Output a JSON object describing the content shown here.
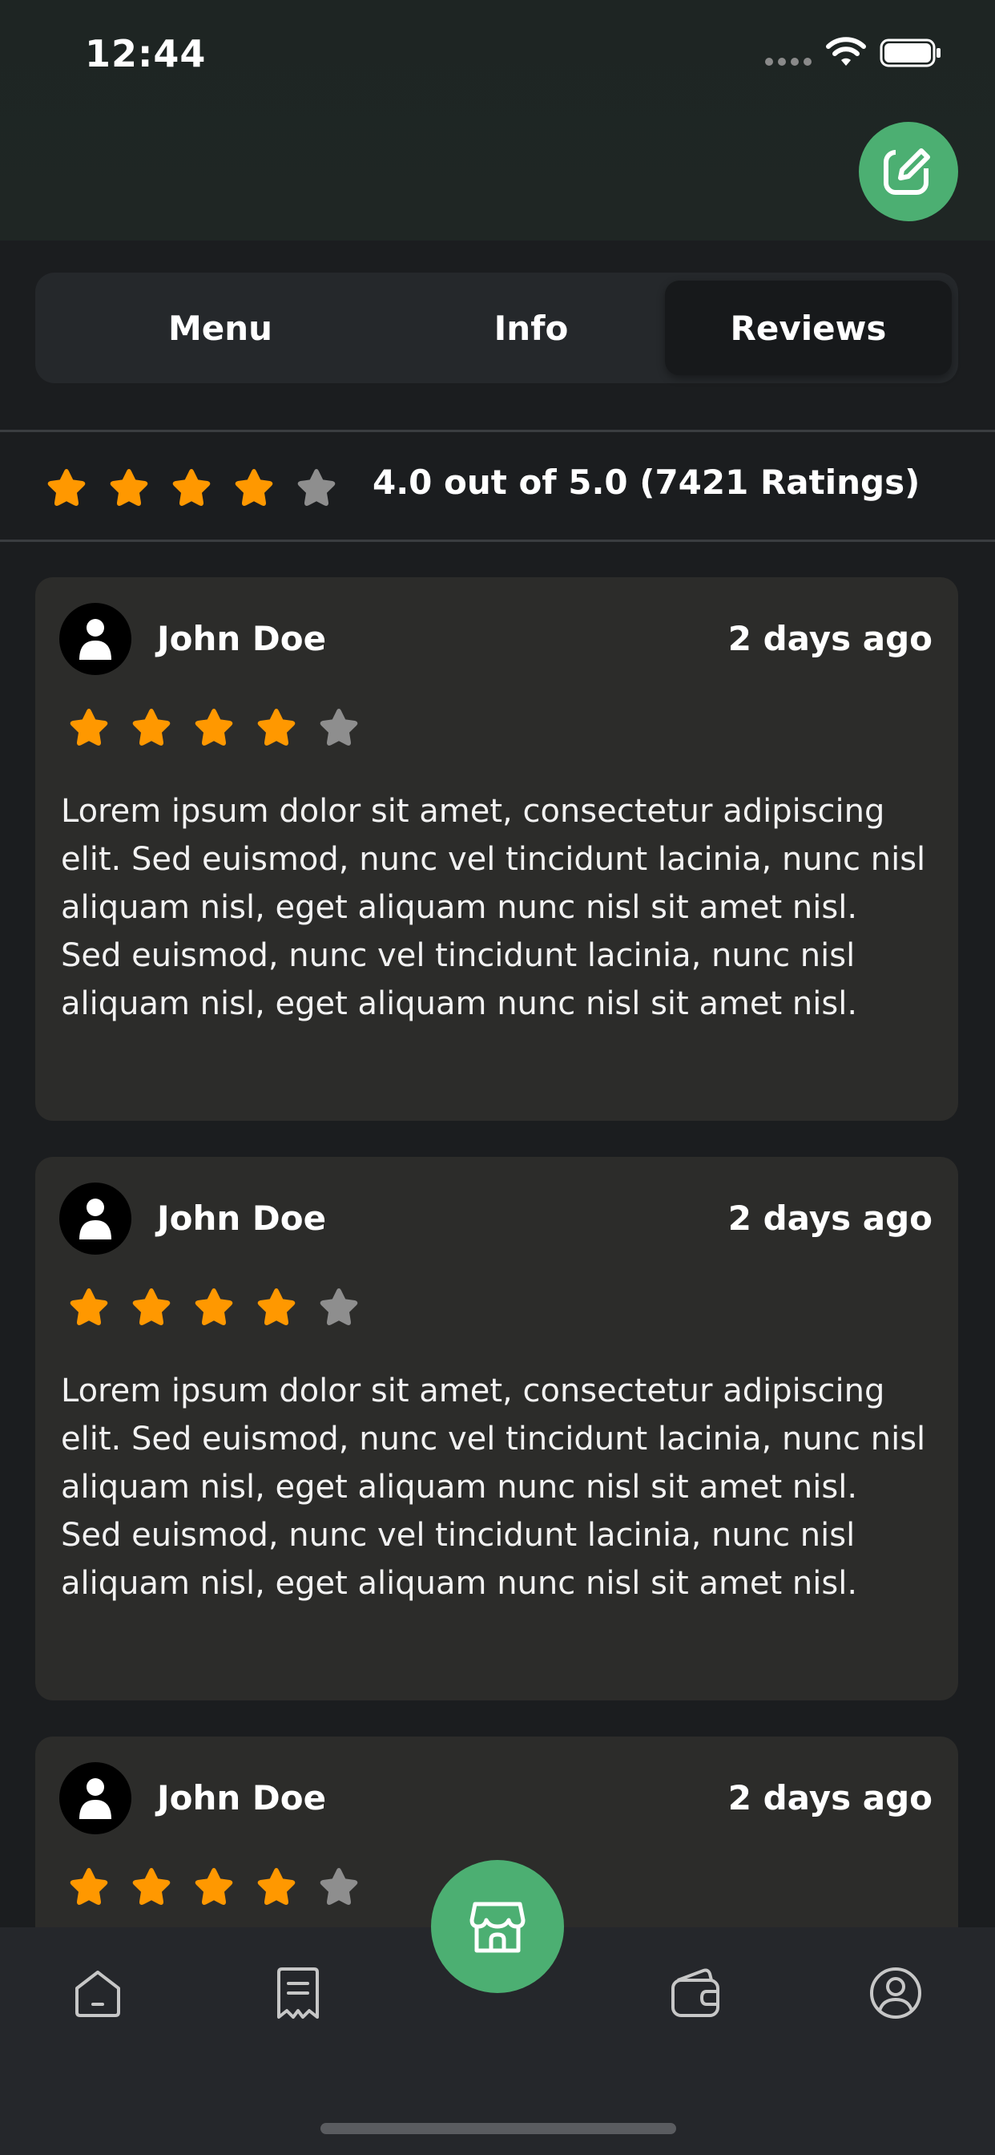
{
  "status_bar": {
    "time": "12:44"
  },
  "tabs": [
    {
      "label": "Menu",
      "selected": false
    },
    {
      "label": "Info",
      "selected": false
    },
    {
      "label": "Reviews",
      "selected": true
    }
  ],
  "overall_rating": {
    "value": 4,
    "max": 5,
    "summary_text": "4.0 out of 5.0 (7421 Ratings)"
  },
  "reviews": [
    {
      "name": "John Doe",
      "date": "2 days ago",
      "rating": 4,
      "text": "Lorem ipsum dolor sit amet, consectetur adipiscing elit. Sed euismod, nunc vel tincidunt lacinia, nunc nisl aliquam nisl, eget aliquam nunc nisl sit amet nisl. Sed euismod, nunc vel tincidunt lacinia, nunc nisl aliquam nisl, eget aliquam nunc nisl sit amet nisl."
    },
    {
      "name": "John Doe",
      "date": "2 days ago",
      "rating": 4,
      "text": "Lorem ipsum dolor sit amet, consectetur adipiscing elit. Sed euismod, nunc vel tincidunt lacinia, nunc nisl aliquam nisl, eget aliquam nunc nisl sit amet nisl. Sed euismod, nunc vel tincidunt lacinia, nunc nisl aliquam nisl, eget aliquam nunc nisl sit amet nisl."
    },
    {
      "name": "John Doe",
      "date": "2 days ago",
      "rating": 4,
      "text": ""
    }
  ],
  "bottom_nav": {
    "items": [
      "home-icon",
      "receipt-icon",
      "store-icon",
      "wallet-icon",
      "profile-icon"
    ],
    "center_action": "store-icon"
  },
  "colors": {
    "accent_green": "#4caf72",
    "star_filled": "#ff9800",
    "star_empty": "#8e8e8e",
    "card_background": "#2c2c2a",
    "page_background": "#1b1d1f"
  }
}
